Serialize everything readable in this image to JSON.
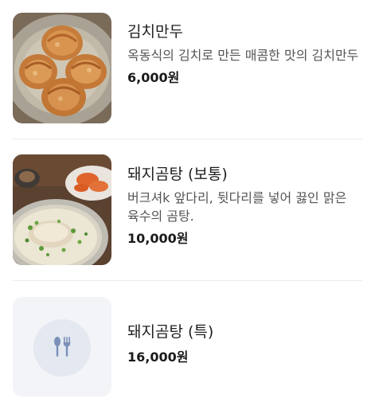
{
  "menu": {
    "items": [
      {
        "name": "김치만두",
        "description": "옥동식의 김치로 만든 매콤한 맛의 김치만두",
        "price": "6,000원",
        "image": "kimchi-dumpling-photo"
      },
      {
        "name": "돼지곰탕 (보통)",
        "description": "버크셔k 앞다리, 뒷다리를 넣어 끓인 맑은 육수의 곰탕.",
        "price": "10,000원",
        "image": "pork-gomtang-photo"
      },
      {
        "name": "돼지곰탕 (특)",
        "price": "16,000원",
        "image": "utensils-icon"
      }
    ]
  }
}
